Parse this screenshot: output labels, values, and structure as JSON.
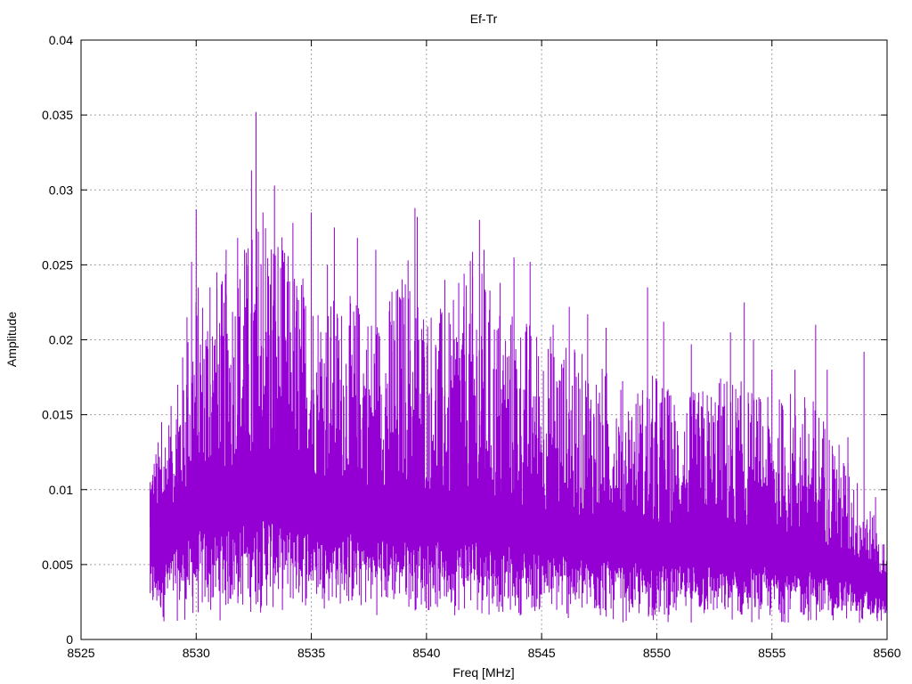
{
  "chart_data": {
    "type": "line",
    "title": "Ef-Tr",
    "xlabel": "Freq [MHz]",
    "ylabel": "Amplitude",
    "xlim": [
      8525,
      8560
    ],
    "ylim": [
      0,
      0.04
    ],
    "x_ticks": [
      "8525",
      "8530",
      "8535",
      "8540",
      "8545",
      "8550",
      "8555",
      "8560"
    ],
    "y_ticks": [
      "0",
      "0.005",
      "0.01",
      "0.015",
      "0.02",
      "0.025",
      "0.03",
      "0.035",
      "0.04"
    ],
    "grid": true,
    "series": [
      {
        "color": "#9400d3",
        "x_start": 8528,
        "x_end": 8560,
        "envelope": {
          "x": [
            8528,
            8529,
            8530,
            8531,
            8532,
            8533,
            8534,
            8535,
            8536,
            8537,
            8538,
            8539,
            8540,
            8541,
            8542,
            8543,
            8544,
            8545,
            8546,
            8547,
            8548,
            8549,
            8550,
            8551,
            8552,
            8553,
            8554,
            8555,
            8556,
            8557,
            8558,
            8559,
            8560
          ],
          "upper": [
            0.012,
            0.016,
            0.024,
            0.024,
            0.026,
            0.03,
            0.026,
            0.024,
            0.023,
            0.023,
            0.022,
            0.025,
            0.023,
            0.022,
            0.026,
            0.023,
            0.022,
            0.021,
            0.02,
            0.019,
            0.018,
            0.017,
            0.018,
            0.016,
            0.017,
            0.018,
            0.017,
            0.016,
            0.017,
            0.016,
            0.013,
            0.01,
            0.006
          ],
          "lower": [
            0.001,
            0.001,
            0.001,
            0.001,
            0.0015,
            0.0015,
            0.0015,
            0.002,
            0.002,
            0.0015,
            0.0015,
            0.002,
            0.0015,
            0.0015,
            0.0015,
            0.0015,
            0.0015,
            0.0015,
            0.001,
            0.001,
            0.001,
            0.001,
            0.001,
            0.001,
            0.001,
            0.001,
            0.001,
            0.001,
            0.001,
            0.001,
            0.001,
            0.001,
            0.001
          ],
          "core": [
            0.0075,
            0.009,
            0.0105,
            0.011,
            0.0115,
            0.012,
            0.0115,
            0.011,
            0.0105,
            0.0105,
            0.01,
            0.0105,
            0.01,
            0.0095,
            0.01,
            0.009,
            0.009,
            0.0085,
            0.0085,
            0.008,
            0.008,
            0.0075,
            0.0075,
            0.0075,
            0.0075,
            0.007,
            0.007,
            0.007,
            0.007,
            0.0065,
            0.006,
            0.005,
            0.0035
          ]
        },
        "peaks": [
          {
            "x": 8528.0,
            "y": 0.0105
          },
          {
            "x": 8528.4,
            "y": 0.0122
          },
          {
            "x": 8528.5,
            "y": 0.0145
          },
          {
            "x": 8529.2,
            "y": 0.017
          },
          {
            "x": 8529.6,
            "y": 0.0215
          },
          {
            "x": 8529.8,
            "y": 0.0252
          },
          {
            "x": 8530.0,
            "y": 0.0287
          },
          {
            "x": 8530.6,
            "y": 0.0235
          },
          {
            "x": 8530.9,
            "y": 0.0245
          },
          {
            "x": 8531.3,
            "y": 0.026
          },
          {
            "x": 8531.8,
            "y": 0.0268
          },
          {
            "x": 8532.1,
            "y": 0.026
          },
          {
            "x": 8532.4,
            "y": 0.0313
          },
          {
            "x": 8532.6,
            "y": 0.0352
          },
          {
            "x": 8532.9,
            "y": 0.0285
          },
          {
            "x": 8533.4,
            "y": 0.0303
          },
          {
            "x": 8533.8,
            "y": 0.0252
          },
          {
            "x": 8534.2,
            "y": 0.0278
          },
          {
            "x": 8535.0,
            "y": 0.0285
          },
          {
            "x": 8535.7,
            "y": 0.025
          },
          {
            "x": 8536.0,
            "y": 0.0275
          },
          {
            "x": 8537.0,
            "y": 0.0268
          },
          {
            "x": 8537.8,
            "y": 0.026
          },
          {
            "x": 8538.5,
            "y": 0.0232
          },
          {
            "x": 8539.2,
            "y": 0.0253
          },
          {
            "x": 8539.5,
            "y": 0.0288
          },
          {
            "x": 8539.6,
            "y": 0.0282
          },
          {
            "x": 8540.8,
            "y": 0.024
          },
          {
            "x": 8541.4,
            "y": 0.0238
          },
          {
            "x": 8542.0,
            "y": 0.0242
          },
          {
            "x": 8542.3,
            "y": 0.028
          },
          {
            "x": 8542.5,
            "y": 0.026
          },
          {
            "x": 8543.2,
            "y": 0.0238
          },
          {
            "x": 8543.8,
            "y": 0.0255
          },
          {
            "x": 8544.5,
            "y": 0.0252
          },
          {
            "x": 8545.5,
            "y": 0.021
          },
          {
            "x": 8546.2,
            "y": 0.0222
          },
          {
            "x": 8547.0,
            "y": 0.0217
          },
          {
            "x": 8547.8,
            "y": 0.0208
          },
          {
            "x": 8549.6,
            "y": 0.0235
          },
          {
            "x": 8550.3,
            "y": 0.0212
          },
          {
            "x": 8551.5,
            "y": 0.0197
          },
          {
            "x": 8553.2,
            "y": 0.0205
          },
          {
            "x": 8553.8,
            "y": 0.0225
          },
          {
            "x": 8554.2,
            "y": 0.02
          },
          {
            "x": 8555.0,
            "y": 0.018
          },
          {
            "x": 8556.0,
            "y": 0.018
          },
          {
            "x": 8556.9,
            "y": 0.021
          },
          {
            "x": 8557.4,
            "y": 0.018
          },
          {
            "x": 8558.3,
            "y": 0.0135
          },
          {
            "x": 8559.0,
            "y": 0.0192
          },
          {
            "x": 8559.5,
            "y": 0.0095
          },
          {
            "x": 8560.0,
            "y": 0.006
          }
        ]
      }
    ]
  }
}
